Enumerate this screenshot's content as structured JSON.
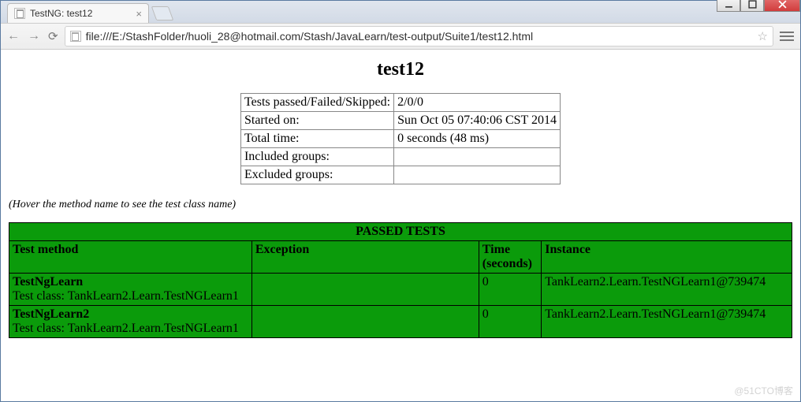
{
  "window": {
    "tab_title": "TestNG: test12",
    "url": "file:///E:/StashFolder/huoli_28@hotmail.com/Stash/JavaLearn/test-output/Suite1/test12.html"
  },
  "page": {
    "title": "test12",
    "hover_note": "(Hover the method name to see the test class name)"
  },
  "summary": {
    "rows": [
      {
        "label": "Tests passed/Failed/Skipped:",
        "value": "2/0/0"
      },
      {
        "label": "Started on:",
        "value": "Sun Oct 05 07:40:06 CST 2014"
      },
      {
        "label": "Total time:",
        "value": "0 seconds (48 ms)"
      },
      {
        "label": "Included groups:",
        "value": ""
      },
      {
        "label": "Excluded groups:",
        "value": ""
      }
    ]
  },
  "results": {
    "section_title": "PASSED TESTS",
    "columns": [
      "Test method",
      "Exception",
      "Time (seconds)",
      "Instance"
    ],
    "rows": [
      {
        "method": "TestNgLearn",
        "class": "Test class: TankLearn2.Learn.TestNGLearn1",
        "exception": "",
        "time": "0",
        "instance": "TankLearn2.Learn.TestNGLearn1@739474"
      },
      {
        "method": "TestNgLearn2",
        "class": "Test class: TankLearn2.Learn.TestNGLearn1",
        "exception": "",
        "time": "0",
        "instance": "TankLearn2.Learn.TestNGLearn1@739474"
      }
    ]
  },
  "watermark": "@51CTO博客"
}
